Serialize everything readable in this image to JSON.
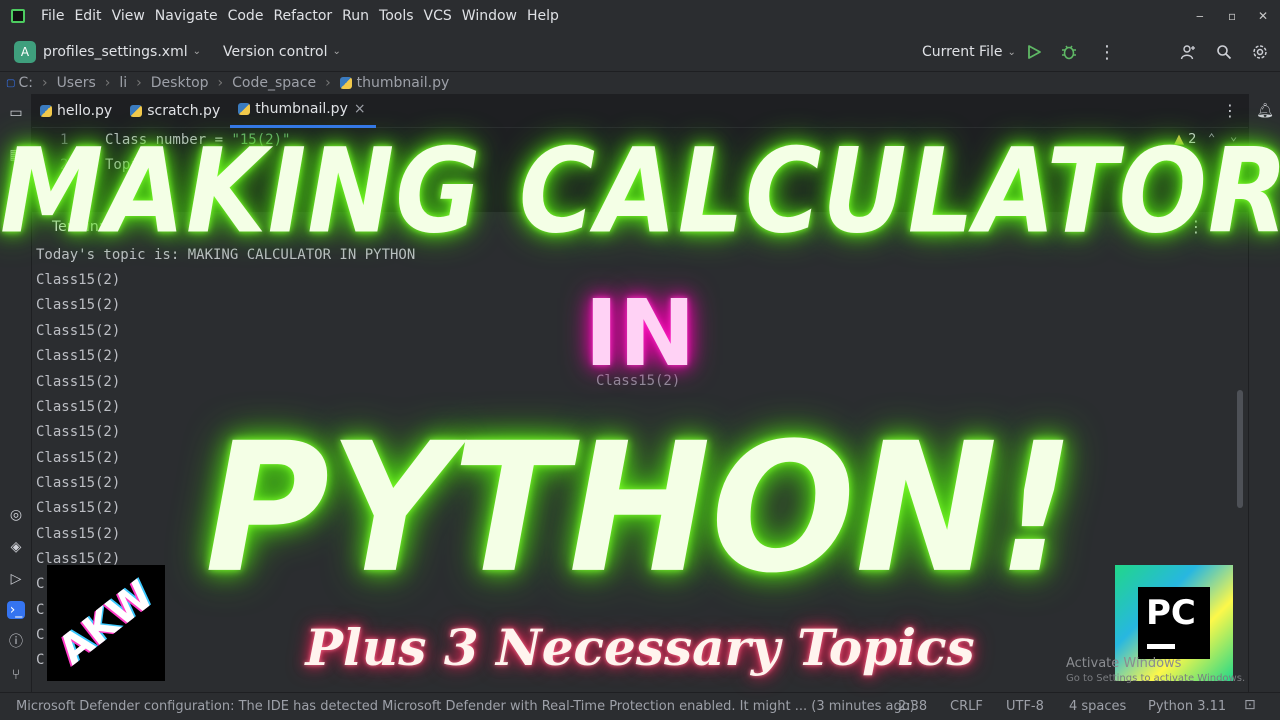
{
  "menubar": {
    "items": [
      "File",
      "Edit",
      "View",
      "Navigate",
      "Code",
      "Refactor",
      "Run",
      "Tools",
      "VCS",
      "Window",
      "Help"
    ],
    "controls": {
      "minimize": "‒",
      "restore": "▫",
      "close": "✕"
    }
  },
  "toolbar": {
    "project_badge": "A",
    "project_name": "profiles_settings.xml",
    "version_control": "Version control",
    "run_config": "Current File"
  },
  "breadcrumb": [
    "C:",
    "Users",
    "li",
    "Desktop",
    "Code_space",
    "thumbnail.py"
  ],
  "tabs": [
    {
      "label": "hello.py"
    },
    {
      "label": "scratch.py"
    },
    {
      "label": "thumbnail.py",
      "close": "×"
    }
  ],
  "editor": {
    "warnings": "2",
    "lines": [
      {
        "num": "1",
        "var": "Class_number = ",
        "str": "\"15(2)\""
      },
      {
        "num": "2",
        "var": "Topic = ",
        "str": ""
      }
    ]
  },
  "terminal": {
    "title": "Terminal",
    "lines": [
      "Today's topic is: MAKING CALCULATOR IN PYTHON",
      "Class15(2)",
      "Class15(2)",
      "Class15(2)",
      "Class15(2)",
      "Class15(2)",
      "Class15(2)",
      "Class15(2)",
      "Class15(2)",
      "Class15(2)",
      "Class15(2)",
      "Class15(2)",
      "Class15(2)",
      "C",
      "C",
      "C",
      "C"
    ],
    "center_text": "Class15(2)"
  },
  "statusbar": {
    "message": "Microsoft Defender configuration: The IDE has detected Microsoft Defender with Real-Time Protection enabled. It might ... (3 minutes ago)",
    "position": "2:38",
    "line_sep": "CRLF",
    "encoding": "UTF-8",
    "indent": "4 spaces",
    "interpreter": "Python 3.11"
  },
  "overlay": {
    "title": "MAKING CALCULATOR",
    "middle": "IN",
    "main": "PYTHON!",
    "subtitle": "Plus 3 Necessary Topics"
  },
  "logos": {
    "left": "AKW",
    "right": "PC"
  },
  "watermark": {
    "line1": "Activate Windows",
    "line2": "Go to Settings to activate Windows."
  },
  "colors": {
    "accent": "#3574f0",
    "neon_green": "#5be11a",
    "neon_pink": "#ff00b8",
    "string_green": "#6aab73"
  }
}
